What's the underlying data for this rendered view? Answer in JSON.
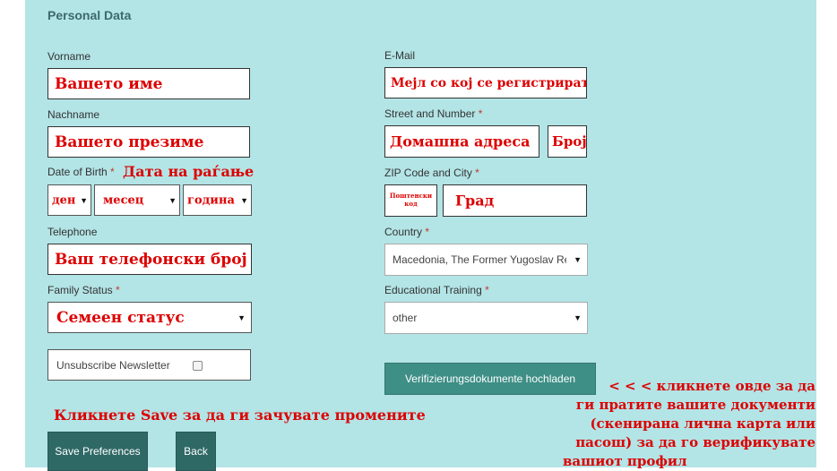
{
  "section_title": "Personal Data",
  "required_mark": "*",
  "left": {
    "vorname": {
      "label": "Vorname",
      "value": "Вашето име"
    },
    "nachname": {
      "label": "Nachname",
      "value": "Вашето презиме"
    },
    "dob": {
      "label": "Date of Birth",
      "hint": "Дата на раѓање",
      "day": "ден",
      "month": "месец",
      "year": "година"
    },
    "telephone": {
      "label": "Telephone",
      "value": "Ваш телефонски број"
    },
    "family_status": {
      "label": "Family Status",
      "value": "Семеен статус"
    },
    "newsletter": {
      "label": "Unsubscribe Newsletter",
      "checked": false
    }
  },
  "right": {
    "email": {
      "label": "E-Mail",
      "value": "Мејл со кој се регистрирате"
    },
    "street": {
      "label": "Street and Number",
      "value": "Домашна адреса",
      "number": "Број"
    },
    "zip_city": {
      "label": "ZIP Code and City",
      "zip": "Поштенски код",
      "city": "Град"
    },
    "country": {
      "label": "Country",
      "value": "Macedonia, The Former Yugoslav Re"
    },
    "education": {
      "label": "Educational Training",
      "value": "other"
    },
    "upload_button": "Verifizierungsdokumente hochladen"
  },
  "annotations": {
    "save_hint": "Кликнете Save за да ги зачувате промените",
    "upload_hint_lines": [
      "< < < кликнете овде за да",
      "ги пратите вашите документи",
      "(скенирана лична карта или",
      "пасош) за да го верификувате",
      "вашиот профил"
    ]
  },
  "buttons": {
    "save": "Save Preferences",
    "back": "Back"
  },
  "colors": {
    "panel": "#b3e4e6",
    "button": "#3e8f86",
    "annotation": "#dd0000"
  }
}
